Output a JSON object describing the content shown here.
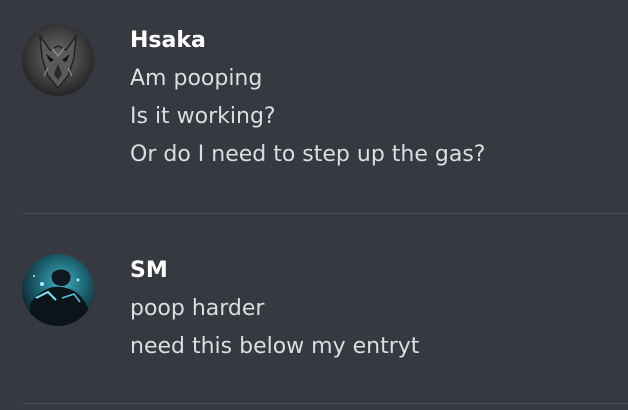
{
  "messages": [
    {
      "author": "Hsaka",
      "avatar_icon": "wolf-avatar",
      "lines": [
        "Am pooping",
        "Is it working?",
        "Or do I need to step up the gas?"
      ]
    },
    {
      "author": "SM",
      "avatar_icon": "cyan-figure-avatar",
      "lines": [
        "poop harder",
        "need this below my entryt"
      ]
    }
  ],
  "colors": {
    "background": "#36393f",
    "divider": "#4b4e55",
    "username": "#ffffff",
    "message_text": "#dcddde"
  }
}
